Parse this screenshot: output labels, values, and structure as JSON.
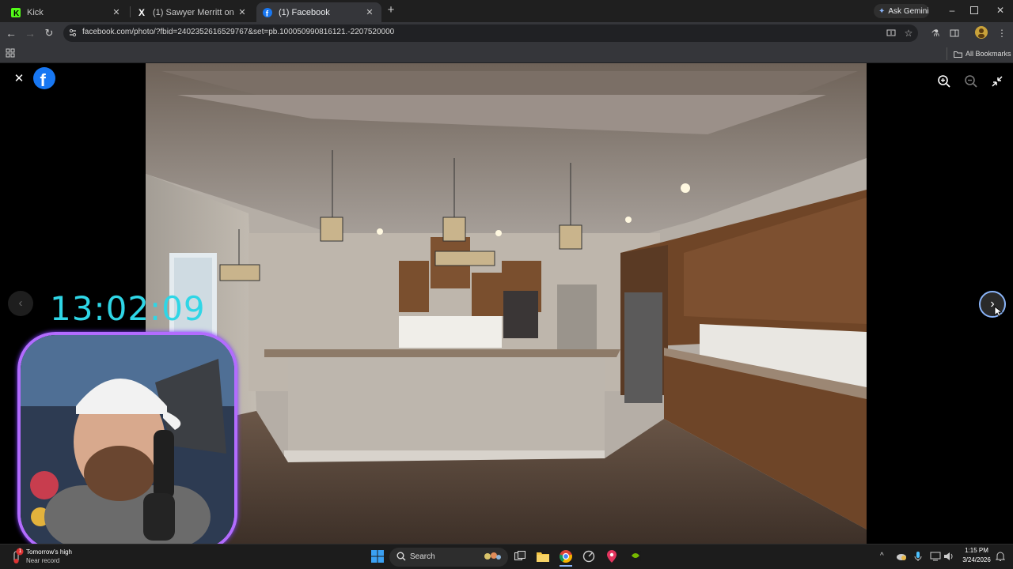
{
  "tabs": [
    {
      "title": "Kick",
      "icon": "kick-icon"
    },
    {
      "title": "(1) Sawyer Merritt on X: \"Holy m",
      "icon": "x-logo-icon"
    },
    {
      "title": "(1) Facebook",
      "icon": "facebook-icon"
    }
  ],
  "ask_gemini": "Ask Gemini",
  "address": {
    "url": "facebook.com/photo/?fbid=2402352616529767&set=pb.100050990816121.-2207520000"
  },
  "bookmarks": {
    "all_label": "All Bookmarks"
  },
  "overlay": {
    "timer": "13:02:09"
  },
  "taskbar": {
    "weather_title": "Tomorrow's high",
    "weather_sub": "Near record",
    "weather_badge": "1",
    "search_label": "Search",
    "time": "1:15 PM",
    "date": "3/24/2026"
  },
  "colors": {
    "facebook": "#1877f2",
    "kick": "#53fc18",
    "timer": "#2fd6e6",
    "cam_border": "#b26cff"
  }
}
